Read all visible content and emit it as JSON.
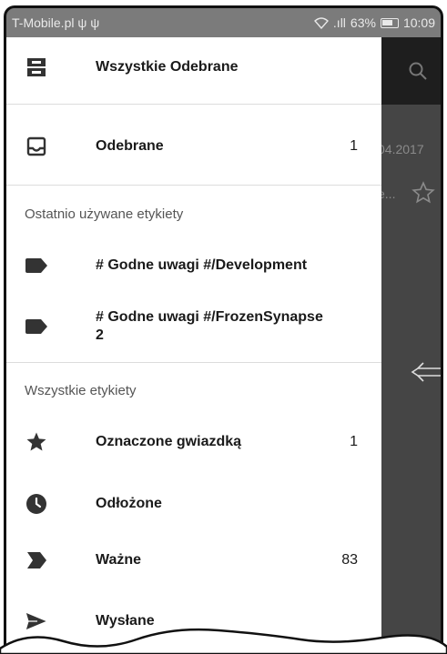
{
  "status": {
    "carrier": "T-Mobile.pl ψ ψ",
    "signal": ".ıll",
    "battery_pct": "63%",
    "time": "10:09"
  },
  "background": {
    "date_fragment": "04.2017",
    "snippet_fragment": "e..."
  },
  "drawer": {
    "top_items": [
      {
        "label": "Wszystkie Odebrane",
        "icon": "all-inbox-icon",
        "count": ""
      },
      {
        "label": "Odebrane",
        "icon": "inbox-icon",
        "count": "1"
      }
    ],
    "recent_section": "Ostatnio używane etykiety",
    "recent_labels": [
      {
        "label": "# Godne uwagi #/Development",
        "icon": "label-icon"
      },
      {
        "label_line1": "# Godne uwagi #/FrozenSynapse",
        "label_line2": "2",
        "icon": "label-icon"
      }
    ],
    "all_section": "Wszystkie etykiety",
    "all_labels": [
      {
        "label": "Oznaczone gwiazdką",
        "icon": "star-icon",
        "count": "1"
      },
      {
        "label": "Odłożone",
        "icon": "clock-icon",
        "count": ""
      },
      {
        "label": "Ważne",
        "icon": "important-icon",
        "count": "83"
      },
      {
        "label": "Wysłane",
        "icon": "send-icon",
        "count": ""
      }
    ]
  },
  "colors": {
    "drawer_bg": "#ffffff",
    "scrim": "#454545",
    "status_bar": "#7b7b7b"
  }
}
